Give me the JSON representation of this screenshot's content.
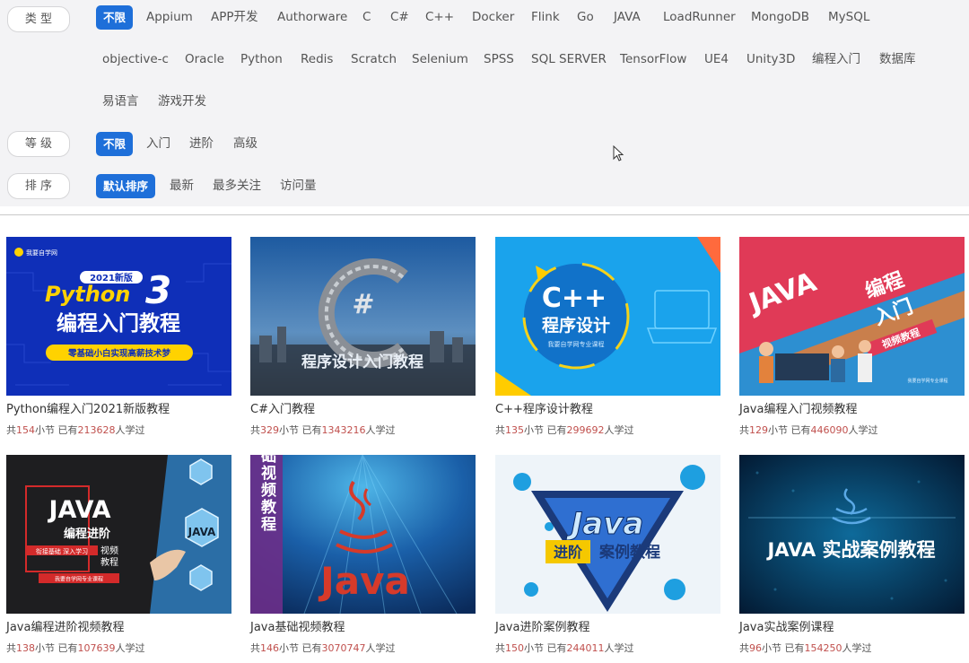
{
  "filters": {
    "type": {
      "label": "类 型",
      "options": [
        "不限",
        "Appium",
        "APP开发",
        "Authorware",
        "C",
        "C#",
        "C++",
        "Docker",
        "Flink",
        "Go",
        "JAVA",
        "LoadRunner",
        "MongoDB",
        "MySQL",
        "objective-c",
        "Oracle",
        "Python",
        "Redis",
        "Scratch",
        "Selenium",
        "SPSS",
        "SQL SERVER",
        "TensorFlow",
        "UE4",
        "Unity3D",
        "编程入门",
        "数据库",
        "易语言",
        "游戏开发"
      ],
      "selected": "不限"
    },
    "level": {
      "label": "等 级",
      "options": [
        "不限",
        "入门",
        "进阶",
        "高级"
      ],
      "selected": "不限"
    },
    "sort": {
      "label": "排 序",
      "options": [
        "默认排序",
        "最新",
        "最多关注",
        "访问量"
      ],
      "selected": "默认排序"
    }
  },
  "courses": [
    {
      "title": "Python编程入门2021新版教程",
      "lessons": "154",
      "learners": "213628",
      "thumb_text": [
        "我要自学网",
        "2021新版",
        "Python",
        "3",
        "编程入门教程",
        "零基础小白实现高薪技术梦"
      ]
    },
    {
      "title": "C#入门教程",
      "lessons": "329",
      "learners": "1343216",
      "thumb_text": [
        "#",
        "程序设计入门教程"
      ]
    },
    {
      "title": "C++程序设计教程",
      "lessons": "135",
      "learners": "299692",
      "thumb_text": [
        "C++",
        "程序设计",
        "我要自学网专业课程"
      ]
    },
    {
      "title": "Java编程入门视频教程",
      "lessons": "129",
      "learners": "446090",
      "thumb_text": [
        "JAVA",
        "编程",
        "入门",
        "视频教程",
        "我要自学网专业课程"
      ]
    },
    {
      "title": "Java编程进阶视频教程",
      "lessons": "138",
      "learners": "107639",
      "thumb_text": [
        "JAVA",
        "编程进阶",
        "视频",
        "教程",
        "衔接基础 深入学习",
        "我要自学网专业课程",
        "JAVA"
      ]
    },
    {
      "title": "Java基础视频教程",
      "lessons": "146",
      "learners": "3070747",
      "thumb_text": [
        "基础视频教程",
        "Java"
      ]
    },
    {
      "title": "Java进阶案例教程",
      "lessons": "150",
      "learners": "244011",
      "thumb_text": [
        "Java",
        "进阶",
        "案例教程"
      ]
    },
    {
      "title": "Java实战案例课程",
      "lessons": "96",
      "learners": "154250",
      "thumb_text": [
        "JAVA 实战案例教程"
      ]
    }
  ],
  "meta_labels": {
    "prefix": "共",
    "lessons_unit": "小节",
    "has": "已有",
    "learners_unit": "人学过"
  },
  "colors": {
    "accent": "#1e6fd9",
    "panel": "#f3f3f5",
    "count": "#c0504d"
  }
}
